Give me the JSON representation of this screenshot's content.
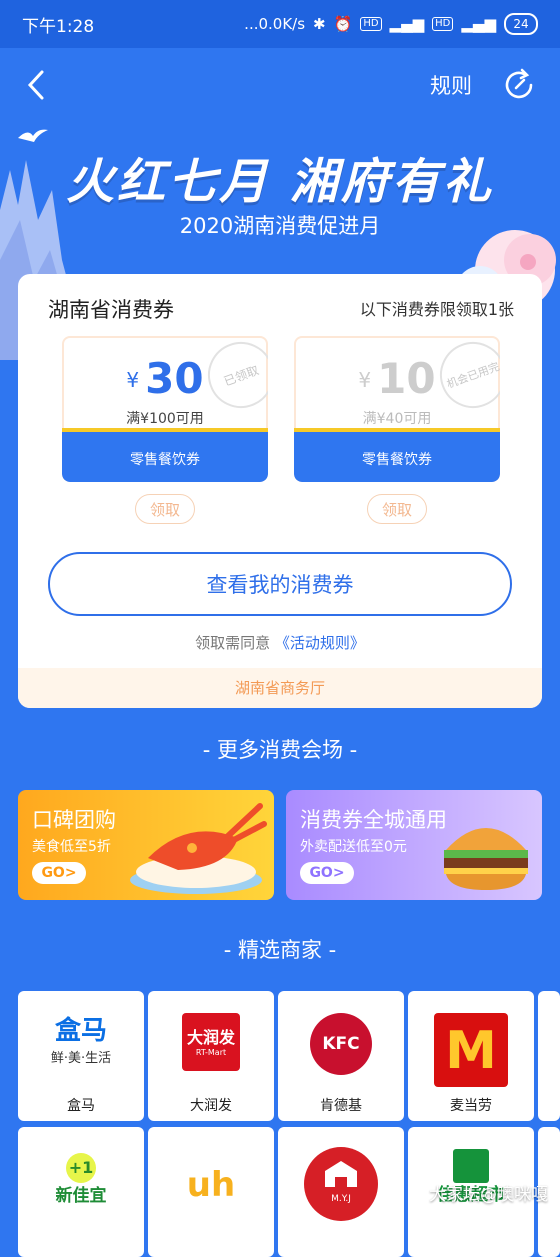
{
  "status_bar": {
    "time": "下午1:28",
    "network_speed": "...0.0K/s",
    "hd1": "HD",
    "hd2": "HD",
    "battery": "24"
  },
  "topbar": {
    "rules_label": "规则"
  },
  "hero": {
    "title": "火红七月 湘府有礼",
    "subtitle": "2020湖南消费促进月"
  },
  "coupon_card": {
    "title": "湖南省消费券",
    "limit_text": "以下消费券限领取1张",
    "coupons": [
      {
        "currency": "¥",
        "amount": "30",
        "condition": "满¥100可用",
        "category": "零售餐饮券",
        "stamp": "已领取",
        "claim_label": "领取"
      },
      {
        "currency": "¥",
        "amount": "10",
        "condition": "满¥40可用",
        "category": "零售餐饮券",
        "stamp": "机会已用完",
        "claim_label": "领取"
      }
    ],
    "view_button": "查看我的消费券",
    "agree_prefix": "领取需同意",
    "agree_link": "《活动规则》",
    "footer": "湖南省商务厅"
  },
  "more_section_title": "- 更多消费会场 -",
  "promos": [
    {
      "title": "口碑团购",
      "subtitle": "美食低至5折",
      "go": "GO>"
    },
    {
      "title": "消费券全城通用",
      "subtitle": "外卖配送低至0元",
      "go": "GO>"
    }
  ],
  "merchants_section_title": "- 精选商家 -",
  "merchants": [
    {
      "name": "盒马",
      "logo_text": "盒马",
      "slogan": "鲜·美·生活"
    },
    {
      "name": "大润发",
      "logo_text": "大润发",
      "logo_sub": "RT-Mart"
    },
    {
      "name": "肯德基",
      "logo_text": "KFC"
    },
    {
      "name": "麦当劳",
      "logo_text": "M"
    },
    {
      "name": "",
      "logo_text": "新佳宜"
    },
    {
      "name": "",
      "logo_text": "uh"
    },
    {
      "name": "",
      "logo_text": "M.Y.J"
    },
    {
      "name": "",
      "logo_text": "佳惠超市"
    }
  ],
  "watermark": "大家坛@噢咪嘎",
  "colors": {
    "background": "#2f76f0",
    "accent": "#2f6fe9",
    "orange": "#f39a55",
    "coupon_gold": "#f6c928"
  }
}
